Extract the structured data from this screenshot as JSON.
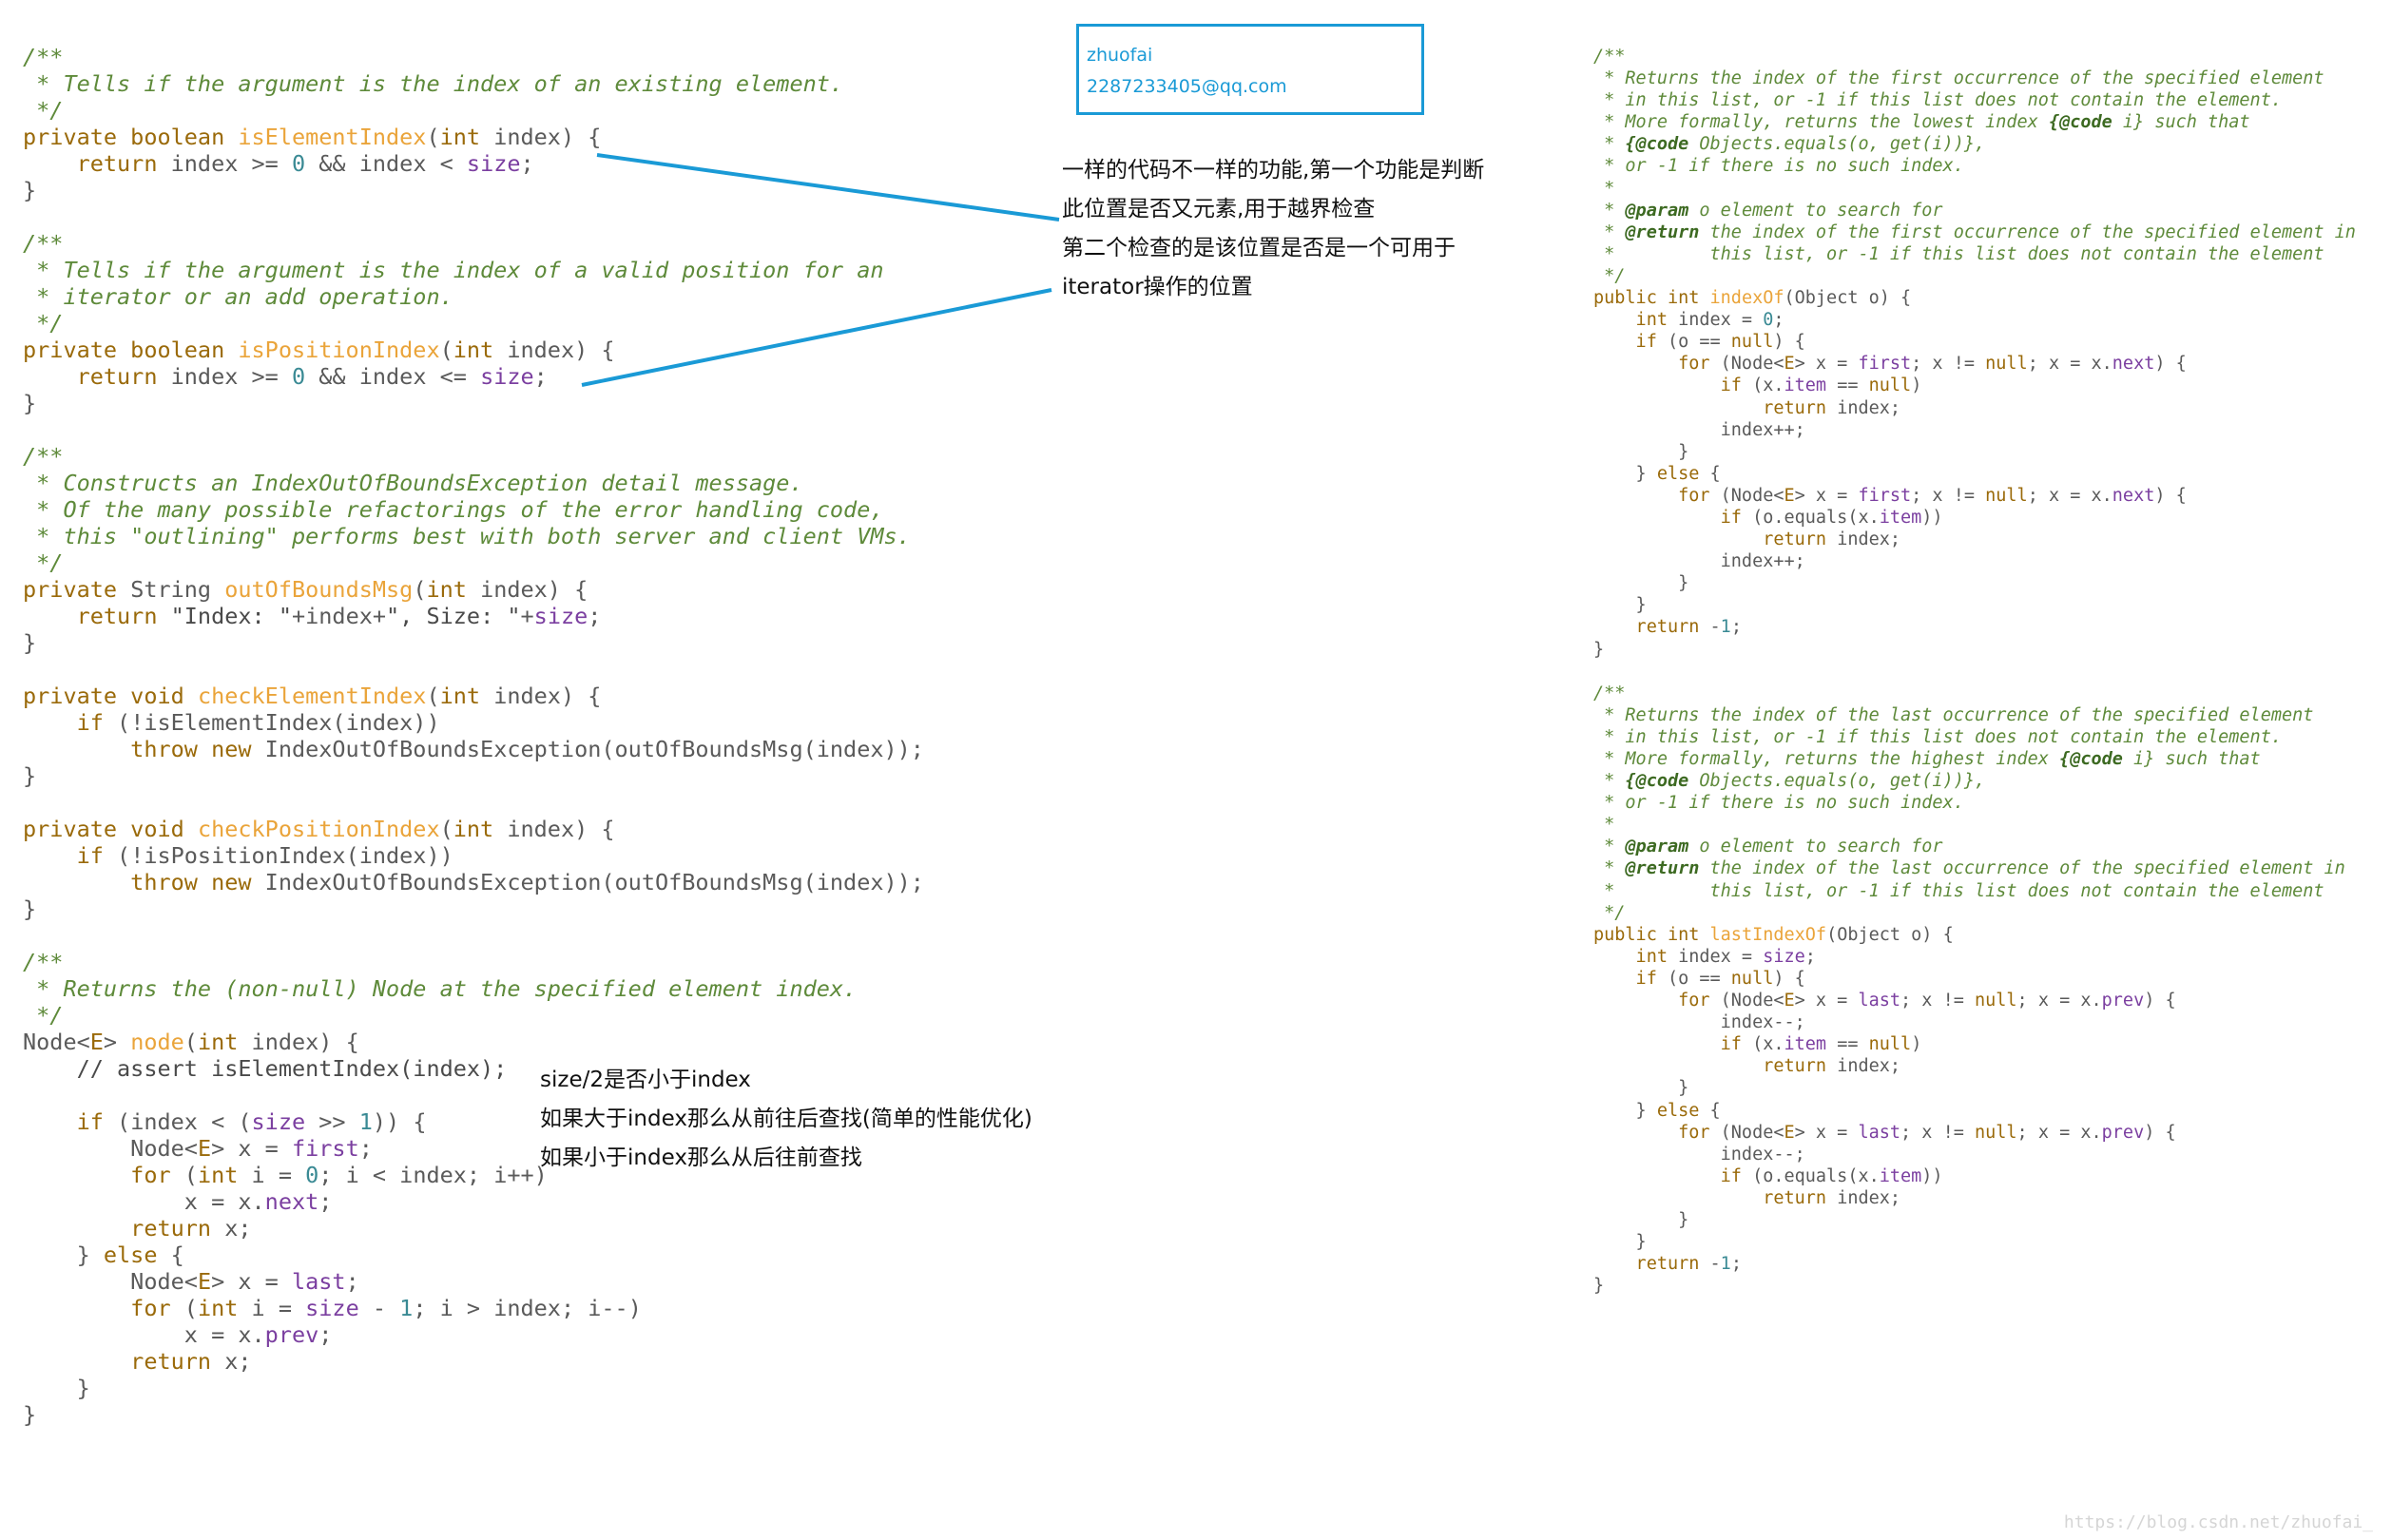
{
  "note_box": {
    "name": "zhuofai",
    "email": "2287233405@qq.com"
  },
  "annotations": {
    "position_check": [
      "一样的代码不一样的功能,第一个功能是判断",
      "此位置是否又元素,用于越界检查",
      "第二个检查的是该位置是否是一个可用于",
      "iterator操作的位置"
    ],
    "node_search": [
      "size/2是否小于index",
      "如果大于index那么从前往后查找(简单的性能优化)",
      "如果小于index那么从后往前查找"
    ]
  },
  "colors": {
    "comment": "#5e8a3a",
    "keyword": "#9a6a0a",
    "method": "#eaa43a",
    "field": "#7b3fa0",
    "number": "#3a8a94",
    "annotation_line": "#1a9ad6"
  },
  "watermark": "https://blog.csdn.net/zhuofai_",
  "code_left": [
    [
      [
        "c",
        "/**"
      ]
    ],
    [
      [
        "c",
        " * Tells if the argument is the index of an existing element."
      ]
    ],
    [
      [
        "c",
        " */"
      ]
    ],
    [
      [
        "k",
        "private boolean "
      ],
      [
        "m",
        "isElementIndex"
      ],
      [
        "p",
        "("
      ],
      [
        "k",
        "int "
      ],
      [
        "p",
        "index) {"
      ]
    ],
    [
      [
        "k",
        "    return "
      ],
      [
        "p",
        "index >= "
      ],
      [
        "n",
        "0"
      ],
      [
        "p",
        " && index < "
      ],
      [
        "f",
        "size"
      ],
      [
        "p",
        ";"
      ]
    ],
    [
      [
        "p",
        "}"
      ]
    ],
    [
      [
        "p",
        ""
      ]
    ],
    [
      [
        "c",
        "/**"
      ]
    ],
    [
      [
        "c",
        " * Tells if the argument is the index of a valid position for an"
      ]
    ],
    [
      [
        "c",
        " * iterator or an add operation."
      ]
    ],
    [
      [
        "c",
        " */"
      ]
    ],
    [
      [
        "k",
        "private boolean "
      ],
      [
        "m",
        "isPositionIndex"
      ],
      [
        "p",
        "("
      ],
      [
        "k",
        "int "
      ],
      [
        "p",
        "index) {"
      ]
    ],
    [
      [
        "k",
        "    return "
      ],
      [
        "p",
        "index >= "
      ],
      [
        "n",
        "0"
      ],
      [
        "p",
        " && index <= "
      ],
      [
        "f",
        "size"
      ],
      [
        "p",
        ";"
      ]
    ],
    [
      [
        "p",
        "}"
      ]
    ],
    [
      [
        "p",
        ""
      ]
    ],
    [
      [
        "c",
        "/**"
      ]
    ],
    [
      [
        "c",
        " * Constructs an IndexOutOfBoundsException detail message."
      ]
    ],
    [
      [
        "c",
        " * Of the many possible refactorings of the error handling code,"
      ]
    ],
    [
      [
        "c",
        " * this \"outlining\" performs best with both server and client VMs."
      ]
    ],
    [
      [
        "c",
        " */"
      ]
    ],
    [
      [
        "k",
        "private "
      ],
      [
        "p",
        "String "
      ],
      [
        "m",
        "outOfBoundsMsg"
      ],
      [
        "p",
        "("
      ],
      [
        "k",
        "int "
      ],
      [
        "p",
        "index) {"
      ]
    ],
    [
      [
        "k",
        "    return "
      ],
      [
        "s",
        "\"Index: \""
      ],
      [
        "p",
        "+index+"
      ],
      [
        "s",
        "\", Size: \""
      ],
      [
        "p",
        "+"
      ],
      [
        "f",
        "size"
      ],
      [
        "p",
        ";"
      ]
    ],
    [
      [
        "p",
        "}"
      ]
    ],
    [
      [
        "p",
        ""
      ]
    ],
    [
      [
        "k",
        "private void "
      ],
      [
        "m",
        "checkElementIndex"
      ],
      [
        "p",
        "("
      ],
      [
        "k",
        "int "
      ],
      [
        "p",
        "index) {"
      ]
    ],
    [
      [
        "k",
        "    if "
      ],
      [
        "p",
        "(!isElementIndex(index))"
      ]
    ],
    [
      [
        "k",
        "        throw new "
      ],
      [
        "p",
        "IndexOutOfBoundsException(outOfBoundsMsg(index));"
      ]
    ],
    [
      [
        "p",
        "}"
      ]
    ],
    [
      [
        "p",
        ""
      ]
    ],
    [
      [
        "k",
        "private void "
      ],
      [
        "m",
        "checkPositionIndex"
      ],
      [
        "p",
        "("
      ],
      [
        "k",
        "int "
      ],
      [
        "p",
        "index) {"
      ]
    ],
    [
      [
        "k",
        "    if "
      ],
      [
        "p",
        "(!isPositionIndex(index))"
      ]
    ],
    [
      [
        "k",
        "        throw new "
      ],
      [
        "p",
        "IndexOutOfBoundsException(outOfBoundsMsg(index));"
      ]
    ],
    [
      [
        "p",
        "}"
      ]
    ],
    [
      [
        "p",
        ""
      ]
    ],
    [
      [
        "c",
        "/**"
      ]
    ],
    [
      [
        "c",
        " * Returns the (non-null) Node at the specified element index."
      ]
    ],
    [
      [
        "c",
        " */"
      ]
    ],
    [
      [
        "p",
        "Node<"
      ],
      [
        "k",
        "E"
      ],
      [
        "p",
        "> "
      ],
      [
        "m",
        "node"
      ],
      [
        "p",
        "("
      ],
      [
        "k",
        "int "
      ],
      [
        "p",
        "index) {"
      ]
    ],
    [
      [
        "s",
        "    // assert isElementIndex(index);"
      ]
    ],
    [
      [
        "p",
        ""
      ]
    ],
    [
      [
        "k",
        "    if "
      ],
      [
        "p",
        "(index < ("
      ],
      [
        "f",
        "size"
      ],
      [
        "p",
        " >> "
      ],
      [
        "n",
        "1"
      ],
      [
        "p",
        ")) {"
      ]
    ],
    [
      [
        "p",
        "        Node<"
      ],
      [
        "k",
        "E"
      ],
      [
        "p",
        "> x = "
      ],
      [
        "f",
        "first"
      ],
      [
        "p",
        ";"
      ]
    ],
    [
      [
        "k",
        "        for "
      ],
      [
        "p",
        "("
      ],
      [
        "k",
        "int "
      ],
      [
        "p",
        "i = "
      ],
      [
        "n",
        "0"
      ],
      [
        "p",
        "; i < index; i++)"
      ]
    ],
    [
      [
        "p",
        "            x = x."
      ],
      [
        "f",
        "next"
      ],
      [
        "p",
        ";"
      ]
    ],
    [
      [
        "k",
        "        return "
      ],
      [
        "p",
        "x;"
      ]
    ],
    [
      [
        "p",
        "    } "
      ],
      [
        "k",
        "else "
      ],
      [
        "p",
        "{"
      ]
    ],
    [
      [
        "p",
        "        Node<"
      ],
      [
        "k",
        "E"
      ],
      [
        "p",
        "> x = "
      ],
      [
        "f",
        "last"
      ],
      [
        "p",
        ";"
      ]
    ],
    [
      [
        "k",
        "        for "
      ],
      [
        "p",
        "("
      ],
      [
        "k",
        "int "
      ],
      [
        "p",
        "i = "
      ],
      [
        "f",
        "size"
      ],
      [
        "p",
        " - "
      ],
      [
        "n",
        "1"
      ],
      [
        "p",
        "; i > index; i--)"
      ]
    ],
    [
      [
        "p",
        "            x = x."
      ],
      [
        "f",
        "prev"
      ],
      [
        "p",
        ";"
      ]
    ],
    [
      [
        "k",
        "        return "
      ],
      [
        "p",
        "x;"
      ]
    ],
    [
      [
        "p",
        "    }"
      ]
    ],
    [
      [
        "p",
        "}"
      ]
    ]
  ],
  "code_right": [
    [
      [
        "c",
        "/**"
      ]
    ],
    [
      [
        "c",
        " * Returns the index of the first occurrence of the specified element"
      ]
    ],
    [
      [
        "c",
        " * in this list, or -1 if this list does not contain the element."
      ]
    ],
    [
      [
        "c",
        " * More formally, returns the lowest index "
      ],
      [
        "g",
        "{@code"
      ],
      [
        "c",
        " i} such that"
      ]
    ],
    [
      [
        "c",
        " * "
      ],
      [
        "g",
        "{@code"
      ],
      [
        "c",
        " Objects.equals(o, get(i))},"
      ]
    ],
    [
      [
        "c",
        " * or -1 if there is no such index."
      ]
    ],
    [
      [
        "c",
        " *"
      ]
    ],
    [
      [
        "c",
        " * "
      ],
      [
        "g",
        "@param"
      ],
      [
        "c",
        " o element to search for"
      ]
    ],
    [
      [
        "c",
        " * "
      ],
      [
        "g",
        "@return"
      ],
      [
        "c",
        " the index of the first occurrence of the specified element in"
      ]
    ],
    [
      [
        "c",
        " *         this list, or -1 if this list does not contain the element"
      ]
    ],
    [
      [
        "c",
        " */"
      ]
    ],
    [
      [
        "k",
        "public int "
      ],
      [
        "m",
        "indexOf"
      ],
      [
        "p",
        "(Object o) {"
      ]
    ],
    [
      [
        "k",
        "    int "
      ],
      [
        "p",
        "index = "
      ],
      [
        "n",
        "0"
      ],
      [
        "p",
        ";"
      ]
    ],
    [
      [
        "k",
        "    if "
      ],
      [
        "p",
        "(o == "
      ],
      [
        "k",
        "null"
      ],
      [
        "p",
        ") {"
      ]
    ],
    [
      [
        "k",
        "        for "
      ],
      [
        "p",
        "(Node<"
      ],
      [
        "k",
        "E"
      ],
      [
        "p",
        "> x = "
      ],
      [
        "f",
        "first"
      ],
      [
        "p",
        "; x != "
      ],
      [
        "k",
        "null"
      ],
      [
        "p",
        "; x = x."
      ],
      [
        "f",
        "next"
      ],
      [
        "p",
        ") {"
      ]
    ],
    [
      [
        "k",
        "            if "
      ],
      [
        "p",
        "(x."
      ],
      [
        "f",
        "item"
      ],
      [
        "p",
        " == "
      ],
      [
        "k",
        "null"
      ],
      [
        "p",
        ")"
      ]
    ],
    [
      [
        "k",
        "                return "
      ],
      [
        "p",
        "index;"
      ]
    ],
    [
      [
        "p",
        "            index++;"
      ]
    ],
    [
      [
        "p",
        "        }"
      ]
    ],
    [
      [
        "p",
        "    } "
      ],
      [
        "k",
        "else "
      ],
      [
        "p",
        "{"
      ]
    ],
    [
      [
        "k",
        "        for "
      ],
      [
        "p",
        "(Node<"
      ],
      [
        "k",
        "E"
      ],
      [
        "p",
        "> x = "
      ],
      [
        "f",
        "first"
      ],
      [
        "p",
        "; x != "
      ],
      [
        "k",
        "null"
      ],
      [
        "p",
        "; x = x."
      ],
      [
        "f",
        "next"
      ],
      [
        "p",
        ") {"
      ]
    ],
    [
      [
        "k",
        "            if "
      ],
      [
        "p",
        "(o.equals(x."
      ],
      [
        "f",
        "item"
      ],
      [
        "p",
        "))"
      ]
    ],
    [
      [
        "k",
        "                return "
      ],
      [
        "p",
        "index;"
      ]
    ],
    [
      [
        "p",
        "            index++;"
      ]
    ],
    [
      [
        "p",
        "        }"
      ]
    ],
    [
      [
        "p",
        "    }"
      ]
    ],
    [
      [
        "k",
        "    return "
      ],
      [
        "p",
        "-"
      ],
      [
        "n",
        "1"
      ],
      [
        "p",
        ";"
      ]
    ],
    [
      [
        "p",
        "}"
      ]
    ],
    [
      [
        "p",
        ""
      ]
    ],
    [
      [
        "c",
        "/**"
      ]
    ],
    [
      [
        "c",
        " * Returns the index of the last occurrence of the specified element"
      ]
    ],
    [
      [
        "c",
        " * in this list, or -1 if this list does not contain the element."
      ]
    ],
    [
      [
        "c",
        " * More formally, returns the highest index "
      ],
      [
        "g",
        "{@code"
      ],
      [
        "c",
        " i} such that"
      ]
    ],
    [
      [
        "c",
        " * "
      ],
      [
        "g",
        "{@code"
      ],
      [
        "c",
        " Objects.equals(o, get(i))},"
      ]
    ],
    [
      [
        "c",
        " * or -1 if there is no such index."
      ]
    ],
    [
      [
        "c",
        " *"
      ]
    ],
    [
      [
        "c",
        " * "
      ],
      [
        "g",
        "@param"
      ],
      [
        "c",
        " o element to search for"
      ]
    ],
    [
      [
        "c",
        " * "
      ],
      [
        "g",
        "@return"
      ],
      [
        "c",
        " the index of the last occurrence of the specified element in"
      ]
    ],
    [
      [
        "c",
        " *         this list, or -1 if this list does not contain the element"
      ]
    ],
    [
      [
        "c",
        " */"
      ]
    ],
    [
      [
        "k",
        "public int "
      ],
      [
        "m",
        "lastIndexOf"
      ],
      [
        "p",
        "(Object o) {"
      ]
    ],
    [
      [
        "k",
        "    int "
      ],
      [
        "p",
        "index = "
      ],
      [
        "f",
        "size"
      ],
      [
        "p",
        ";"
      ]
    ],
    [
      [
        "k",
        "    if "
      ],
      [
        "p",
        "(o == "
      ],
      [
        "k",
        "null"
      ],
      [
        "p",
        ") {"
      ]
    ],
    [
      [
        "k",
        "        for "
      ],
      [
        "p",
        "(Node<"
      ],
      [
        "k",
        "E"
      ],
      [
        "p",
        "> x = "
      ],
      [
        "f",
        "last"
      ],
      [
        "p",
        "; x != "
      ],
      [
        "k",
        "null"
      ],
      [
        "p",
        "; x = x."
      ],
      [
        "f",
        "prev"
      ],
      [
        "p",
        ") {"
      ]
    ],
    [
      [
        "p",
        "            index--;"
      ]
    ],
    [
      [
        "k",
        "            if "
      ],
      [
        "p",
        "(x."
      ],
      [
        "f",
        "item"
      ],
      [
        "p",
        " == "
      ],
      [
        "k",
        "null"
      ],
      [
        "p",
        ")"
      ]
    ],
    [
      [
        "k",
        "                return "
      ],
      [
        "p",
        "index;"
      ]
    ],
    [
      [
        "p",
        "        }"
      ]
    ],
    [
      [
        "p",
        "    } "
      ],
      [
        "k",
        "else "
      ],
      [
        "p",
        "{"
      ]
    ],
    [
      [
        "k",
        "        for "
      ],
      [
        "p",
        "(Node<"
      ],
      [
        "k",
        "E"
      ],
      [
        "p",
        "> x = "
      ],
      [
        "f",
        "last"
      ],
      [
        "p",
        "; x != "
      ],
      [
        "k",
        "null"
      ],
      [
        "p",
        "; x = x."
      ],
      [
        "f",
        "prev"
      ],
      [
        "p",
        ") {"
      ]
    ],
    [
      [
        "p",
        "            index--;"
      ]
    ],
    [
      [
        "k",
        "            if "
      ],
      [
        "p",
        "(o.equals(x."
      ],
      [
        "f",
        "item"
      ],
      [
        "p",
        "))"
      ]
    ],
    [
      [
        "k",
        "                return "
      ],
      [
        "p",
        "index;"
      ]
    ],
    [
      [
        "p",
        "        }"
      ]
    ],
    [
      [
        "p",
        "    }"
      ]
    ],
    [
      [
        "k",
        "    return "
      ],
      [
        "p",
        "-"
      ],
      [
        "n",
        "1"
      ],
      [
        "p",
        ";"
      ]
    ],
    [
      [
        "p",
        "}"
      ]
    ]
  ]
}
